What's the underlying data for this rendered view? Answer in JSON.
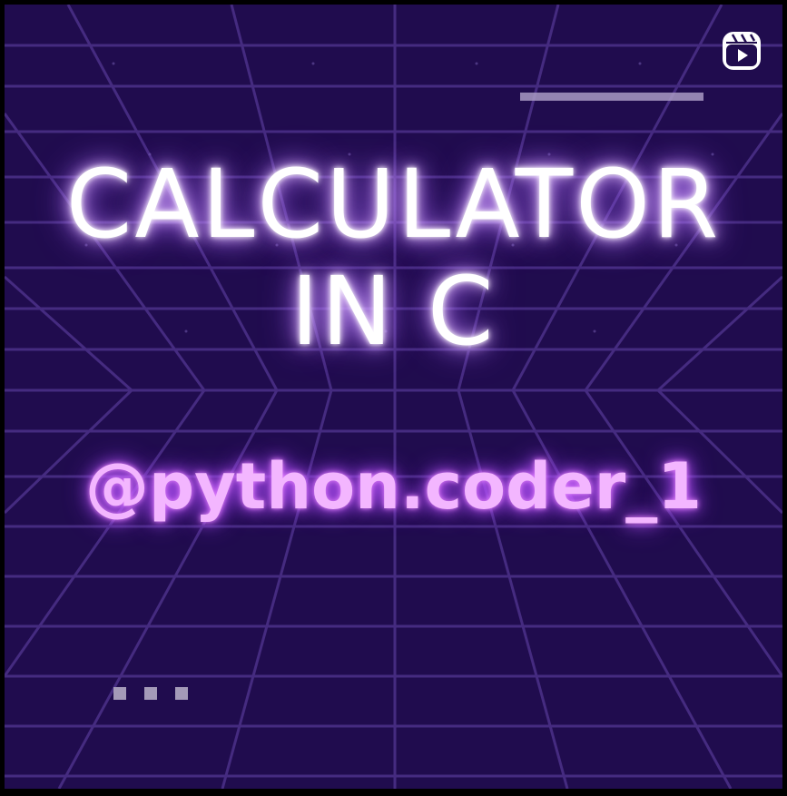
{
  "post": {
    "title_line1": "CALCULATOR",
    "title_line2": "IN C",
    "handle": "@python.coder_1",
    "media_type_icon": "reels-icon",
    "colors": {
      "background": "#200c4e",
      "grid": "#4a2f86",
      "title_glow": "#c58cff",
      "handle_text": "#f3b6ff"
    },
    "pagination_dots": 3
  }
}
